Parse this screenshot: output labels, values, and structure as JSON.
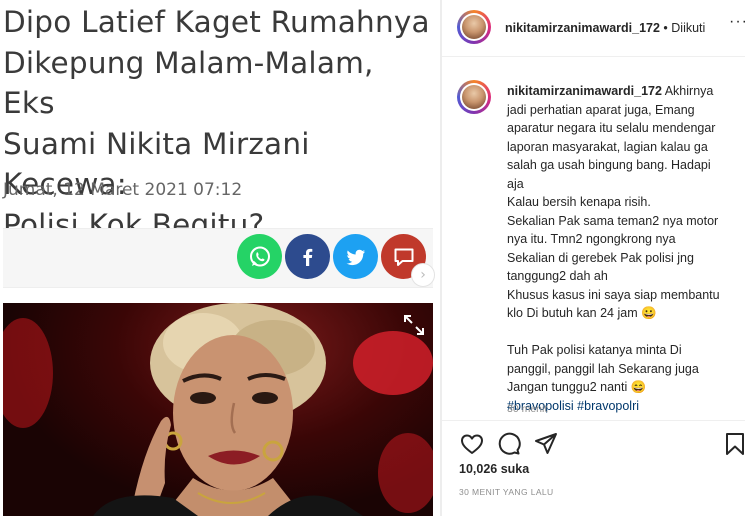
{
  "article": {
    "headline_lines": [
      "Dipo Latief Kaget Rumahnya",
      "Dikepung Malam-Malam, Eks",
      "Suami Nikita Mirzani Kecewa:",
      "Polisi Kok Begitu?"
    ],
    "date": "Jumat, 12 Maret 2021 07:12",
    "share": [
      {
        "name": "whatsapp",
        "color": "#25d366"
      },
      {
        "name": "facebook",
        "color": "#2d4b8e"
      },
      {
        "name": "twitter",
        "color": "#1da1f2"
      },
      {
        "name": "comment",
        "color": "#c0392b"
      }
    ],
    "scroll_glyph": "›"
  },
  "instagram": {
    "header_username": "nikitamirzanimawardi_172",
    "header_follow": " • Diikuti",
    "more_glyph": "···",
    "caption_username": "nikitamirzanimawardi_172",
    "caption_lines": [
      " Akhirnya",
      "jadi perhatian aparat juga, Emang",
      "aparatur negara itu selalu mendengar",
      "laporan masyarakat, lagian kalau ga",
      "salah ga usah bingung bang. Hadapi",
      "aja",
      "Kalau bersih kenapa risih.",
      "Sekalian Pak sama teman2 nya motor",
      "nya itu. Tmn2 ngongkrong nya",
      "Sekalian di gerebek Pak polisi jng",
      "tanggung2 dah ah",
      "Khusus kasus ini saya siap membantu",
      "klo Di butuh kan 24 jam 😀",
      "",
      "Tuh Pak polisi katanya minta Di",
      "panggil, panggil lah Sekarang juga",
      "Jangan tunggu2 nanti 😄"
    ],
    "hashtags": "#bravopolisi #bravopolri",
    "caption_time": "30 menit",
    "likes": "10,026 suka",
    "time_ago": "30 MENIT YANG LALU",
    "action_icons": [
      "heart-icon",
      "comment-icon",
      "share-icon",
      "bookmark-icon"
    ]
  }
}
